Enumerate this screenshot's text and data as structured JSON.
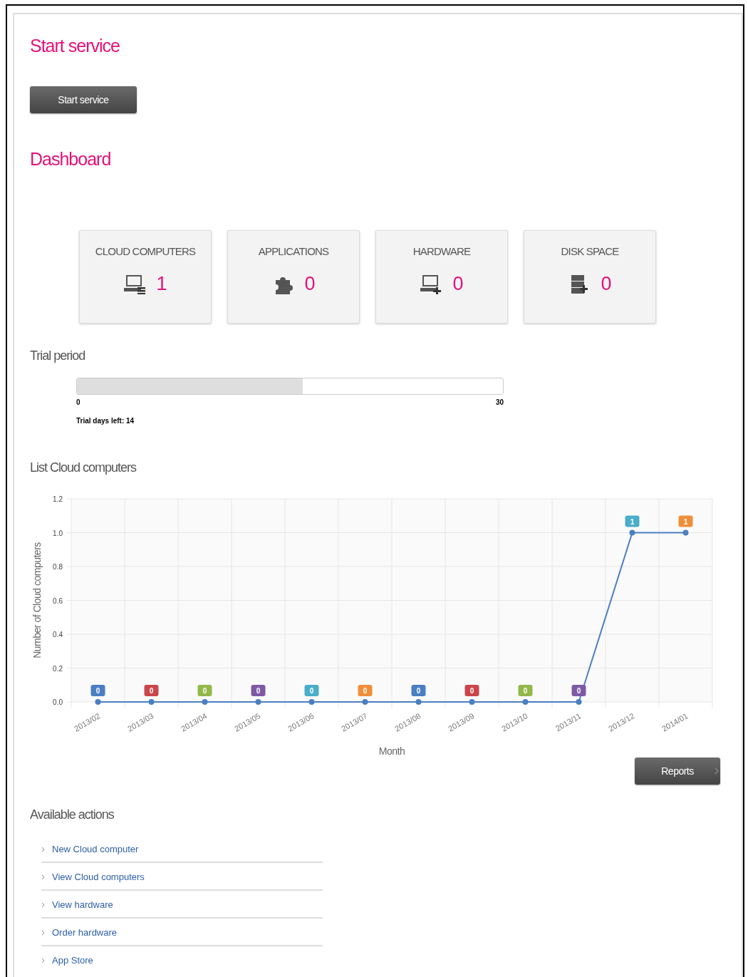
{
  "start_service": {
    "heading": "Start service",
    "button": "Start service"
  },
  "dashboard": {
    "heading": "Dashboard",
    "counters": [
      {
        "kind": "computer",
        "label": "CLOUD COMPUTERS",
        "value": "1"
      },
      {
        "kind": "application",
        "label": "APPLICATIONS",
        "value": "0"
      },
      {
        "kind": "hardware",
        "label": "HARDWARE",
        "value": "0"
      },
      {
        "kind": "disk",
        "label": "DISK SPACE",
        "value": "0"
      }
    ]
  },
  "trial": {
    "heading": "Trial period",
    "level": 0.53,
    "min": "0",
    "max": "30",
    "days_left": "Trial days left: 14"
  },
  "chart": {
    "heading": "List Cloud computers",
    "chart_data": {
      "type": "line",
      "xlabel": "Month",
      "ylabel": "Number of Cloud computers",
      "categories": [
        "2013/02",
        "2013/03",
        "2013/04",
        "2013/05",
        "2013/06",
        "2013/07",
        "2013/08",
        "2013/09",
        "2013/10",
        "2013/11",
        "2013/12",
        "2014/01"
      ],
      "series": [
        {
          "color": "#4a7fc1",
          "marker": true,
          "values": [
            0,
            0,
            0,
            0,
            0,
            0,
            0,
            0,
            0,
            0,
            1,
            1
          ]
        }
      ],
      "grid": true,
      "ylim": [
        0,
        1.2
      ],
      "yticks": [
        {
          "value": 0,
          "label": "0.0"
        },
        {
          "value": 0.2,
          "label": "0.2"
        },
        {
          "value": 0.4,
          "label": "0.4"
        },
        {
          "value": 0.6,
          "label": "0.6"
        },
        {
          "value": 0.8,
          "label": "0.8"
        },
        {
          "value": 1,
          "label": "1.0"
        },
        {
          "value": 1.2,
          "label": "1.2"
        }
      ],
      "data_labels": true
    },
    "button": "Reports"
  },
  "actions": {
    "heading": "Available actions",
    "items": [
      "New Cloud computer",
      "View Cloud computers",
      "View hardware",
      "Order hardware",
      "App Store"
    ]
  }
}
